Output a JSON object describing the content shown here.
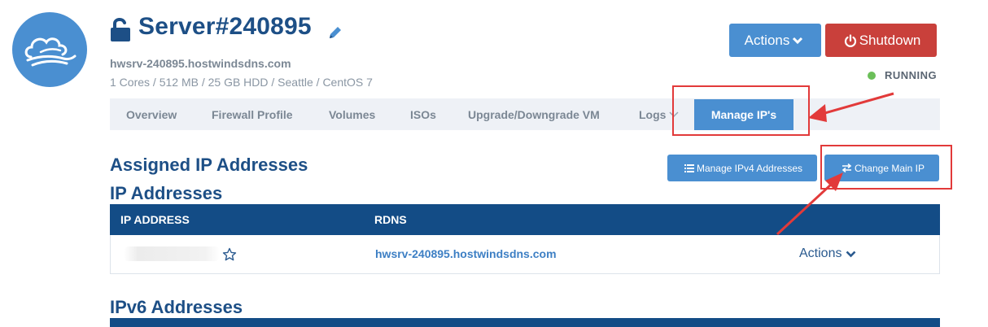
{
  "server": {
    "title": "Server#240895",
    "hostname": "hwsrv-240895.hostwindsdns.com",
    "specs": "1 Cores / 512 MB / 25 GB HDD / Seattle / CentOS 7",
    "status": "RUNNING",
    "status_color": "#6bbf59"
  },
  "header_buttons": {
    "actions_label": "Actions",
    "shutdown_label": "Shutdown"
  },
  "tabs": [
    {
      "label": "Overview"
    },
    {
      "label": "Firewall Profile"
    },
    {
      "label": "Volumes"
    },
    {
      "label": "ISOs"
    },
    {
      "label": "Upgrade/Downgrade VM"
    },
    {
      "label": "Logs"
    },
    {
      "label": "Manage IP's",
      "active": true
    }
  ],
  "section": {
    "assigned_title": "Assigned IP Addresses",
    "ip_title": "IP Addresses",
    "ipv6_title": "IPv6 Addresses",
    "manage_ipv4_label": "Manage IPv4 Addresses",
    "change_main_ip_label": "Change Main IP"
  },
  "ip_table": {
    "columns": [
      "IP ADDRESS",
      "RDNS"
    ],
    "rows": [
      {
        "rdns": "hwsrv-240895.hostwindsdns.com",
        "actions_label": "Actions"
      }
    ]
  },
  "icons": {
    "logo": "cloud-wind-icon",
    "lock": "unlock-icon",
    "edit": "pencil-icon",
    "favorite": "star-outline-icon",
    "shutdown": "power-icon",
    "list": "list-icon",
    "swap": "swap-arrows-icon"
  },
  "colors": {
    "primary": "#4a8fd1",
    "danger": "#c9403b",
    "navy": "#134c86",
    "heading": "#1d4f86",
    "annotation": "#e23a3a"
  }
}
